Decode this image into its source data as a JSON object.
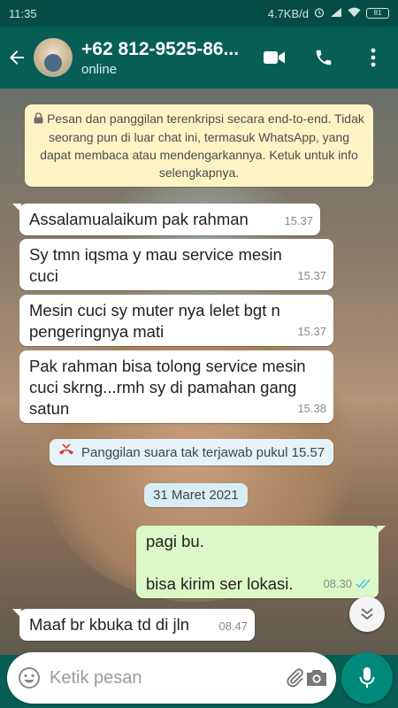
{
  "status_bar": {
    "time": "11:35",
    "network_speed": "4.7KB/d",
    "battery": "81"
  },
  "header": {
    "contact_name": "+62 812-9525-86...",
    "status": "online"
  },
  "encryption_notice": "Pesan dan panggilan terenkripsi secara end-to-end. Tidak seorang pun di luar chat ini, termasuk WhatsApp, yang dapat membaca atau mendengarkannya. Ketuk untuk info selengkapnya.",
  "messages": [
    {
      "lines": [
        "Assalamualaikum pak rahman"
      ],
      "time": "15.37"
    },
    {
      "lines": [
        "Sy tmn iqsma y mau service mesin",
        "cuci"
      ],
      "time": "15.37"
    },
    {
      "lines": [
        "Mesin cuci sy muter nya lelet bgt n",
        "pengeringnya mati"
      ],
      "time": "15.37"
    },
    {
      "lines": [
        "Pak rahman bisa tolong service mesin",
        "cuci skrng...rmh sy di pamahan gang",
        "satun"
      ],
      "time": "15.38"
    }
  ],
  "missed_call": "Panggilan suara tak terjawab pukul 15.57",
  "date_chip": "31 Maret 2021",
  "outgoing": {
    "lines": [
      "pagi bu.",
      "",
      "bisa kirim ser lokasi."
    ],
    "time": "08.30"
  },
  "last_message": {
    "lines": [
      "Maaf br kbuka td di jln"
    ],
    "time": "08.47"
  },
  "input": {
    "placeholder": "Ketik pesan"
  },
  "colors": {
    "header": "#075e54",
    "outgoing_bubble": "#dcf8c6",
    "incoming_bubble": "#ffffff",
    "notice": "#fdf4c5",
    "fab": "#00897b",
    "read_ticks": "#4fc3f7"
  }
}
